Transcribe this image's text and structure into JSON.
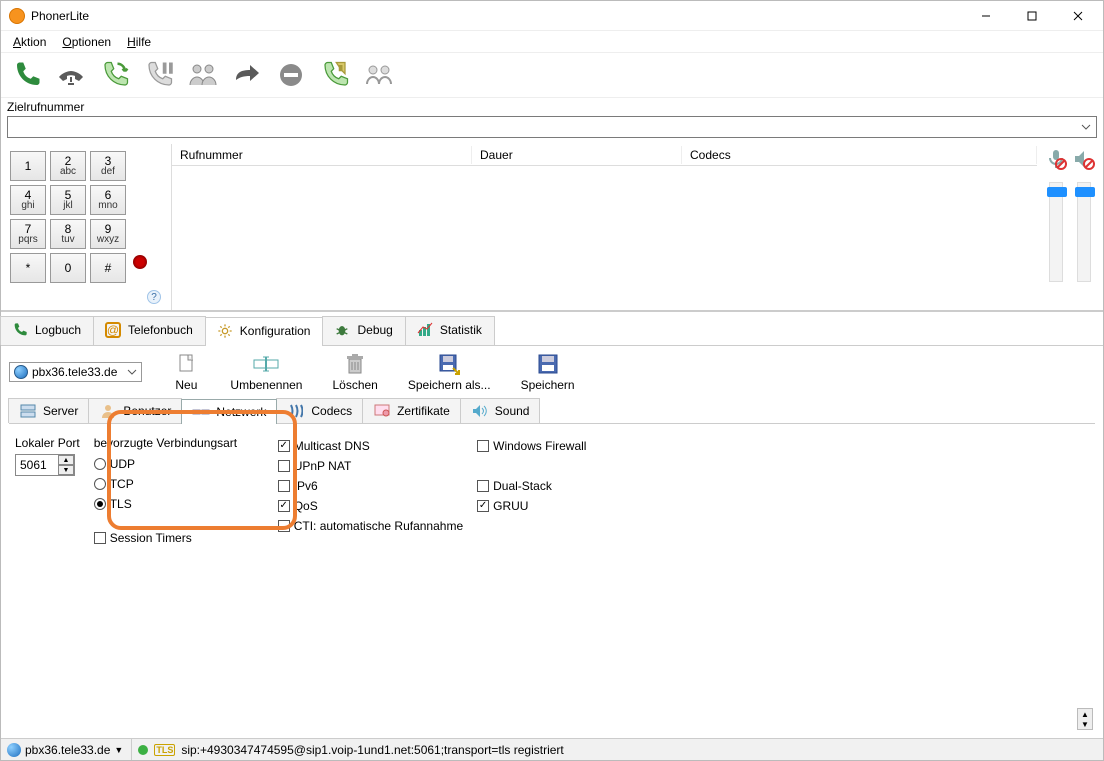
{
  "window": {
    "title": "PhonerLite"
  },
  "menu": {
    "aktion": "Aktion",
    "optionen": "Optionen",
    "hilfe": "Hilfe"
  },
  "dial": {
    "label": "Zielrufnummer"
  },
  "keypad": {
    "k1_n": "1",
    "k1_l": "",
    "k2_n": "2",
    "k2_l": "abc",
    "k3_n": "3",
    "k3_l": "def",
    "k4_n": "4",
    "k4_l": "ghi",
    "k5_n": "5",
    "k5_l": "jkl",
    "k6_n": "6",
    "k6_l": "mno",
    "k7_n": "7",
    "k7_l": "pqrs",
    "k8_n": "8",
    "k8_l": "tuv",
    "k9_n": "9",
    "k9_l": "wxyz",
    "kstar": "*",
    "k0": "0",
    "khash": "#"
  },
  "call_columns": {
    "a": "Rufnummer",
    "b": "Dauer",
    "c": "Codecs"
  },
  "tabs": {
    "logbuch": "Logbuch",
    "telefonbuch": "Telefonbuch",
    "konfiguration": "Konfiguration",
    "debug": "Debug",
    "statistik": "Statistik"
  },
  "profile": {
    "name": "pbx36.tele33.de"
  },
  "cfgtoolbar": {
    "neu": "Neu",
    "umbenennen": "Umbenennen",
    "loeschen": "Löschen",
    "speichern_als": "Speichern als...",
    "speichern": "Speichern"
  },
  "subtabs": {
    "server": "Server",
    "benutzer": "Benutzer",
    "netzwerk": "Netzwerk",
    "codecs": "Codecs",
    "zertifikate": "Zertifikate",
    "sound": "Sound"
  },
  "netcfg": {
    "local_port_label": "Lokaler Port",
    "local_port_value": "5061",
    "conn_heading": "bevorzugte Verbindungsart",
    "udp": "UDP",
    "tcp": "TCP",
    "tls": "TLS",
    "session_timers": "Session Timers",
    "multicast": "Multicast DNS",
    "upnp": "UPnP NAT",
    "ipv6": "IPv6",
    "qos": "QoS",
    "winfw": "Windows Firewall",
    "dualstack": "Dual-Stack",
    "gruu": "GRUU",
    "cti": "CTI: automatische Rufannahme"
  },
  "status": {
    "profile": "pbx36.tele33.de",
    "sip": "sip:+4930347474595@sip1.voip-1und1.net:5061;transport=tls registriert"
  }
}
